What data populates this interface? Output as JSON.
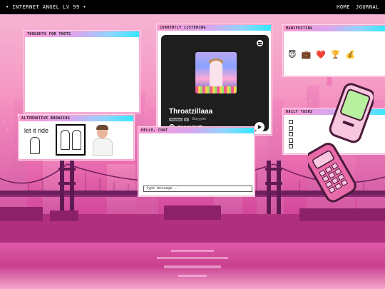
{
  "site": {
    "title": "• INTERNET ANGEL LV 99 •",
    "nav": [
      "HOME",
      "JOURNAL"
    ]
  },
  "windows": {
    "thots": {
      "title": "THOUGHTS FOR THOTS"
    },
    "listening": {
      "title": "CURRENTLY LISTENING",
      "track": "Throatzillaaa",
      "badges": [
        "Preview",
        "E"
      ],
      "artist": "Slayyyter",
      "save_label": "Save on Spotify"
    },
    "manifest": {
      "title": "MANIFESTING",
      "icons": [
        "😇",
        "💼",
        "❤️",
        "🏆",
        "💰"
      ]
    },
    "tasks": {
      "title": "DAILY TASKS",
      "count": 5
    },
    "browse": {
      "title": "ALTERNATIVE BROWSING",
      "gif1_caption": "let it ride"
    },
    "chat": {
      "title": "HELLO, CHAT",
      "placeholder": "type message..."
    }
  },
  "colors": {
    "titlebar_start": "#ff9ad4",
    "titlebar_end": "#33e8ff",
    "sky_top": "#f7b9d6",
    "sky_bottom": "#b12f86",
    "spotify_bg": "#1e1e1e",
    "phone": "#e86aa8",
    "phone_screen": "#b8f0a0"
  }
}
